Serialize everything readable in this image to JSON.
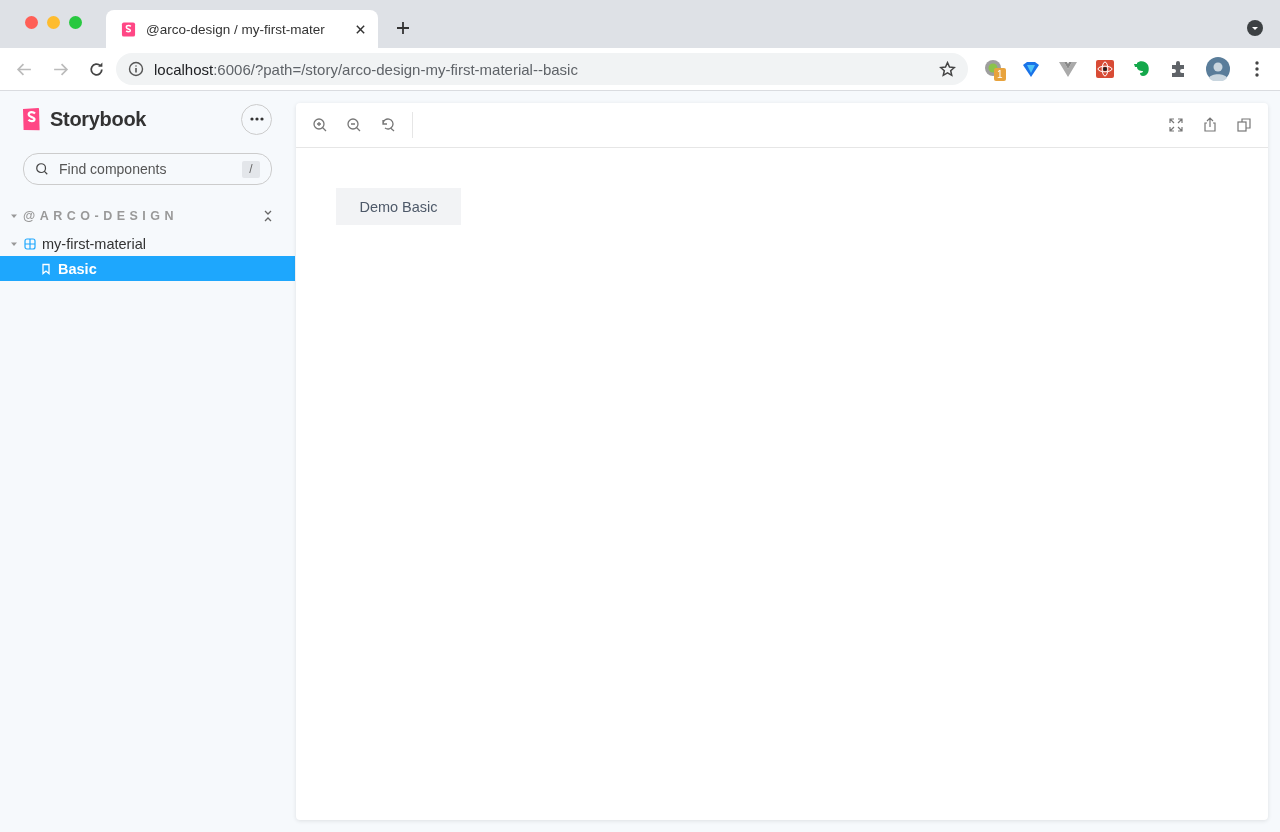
{
  "browser": {
    "tab": {
      "title": "@arco-design / my-first-mater",
      "selected": true
    },
    "address": {
      "host": "localhost",
      "rest": ":6006/?path=/story/arco-design-my-first-material--basic"
    },
    "extension_badge": "1"
  },
  "sidebar": {
    "brand": "Storybook",
    "search": {
      "placeholder": "Find components",
      "shortcut": "/"
    },
    "tree": [
      {
        "kind": "group",
        "label": "@ARCO-DESIGN",
        "expanded": true,
        "children": [
          {
            "kind": "component",
            "label": "my-first-material",
            "expanded": true,
            "selected": false,
            "children": [
              {
                "kind": "story",
                "label": "Basic",
                "selected": true
              }
            ]
          }
        ]
      }
    ]
  },
  "preview": {
    "button": "Demo Basic"
  }
}
